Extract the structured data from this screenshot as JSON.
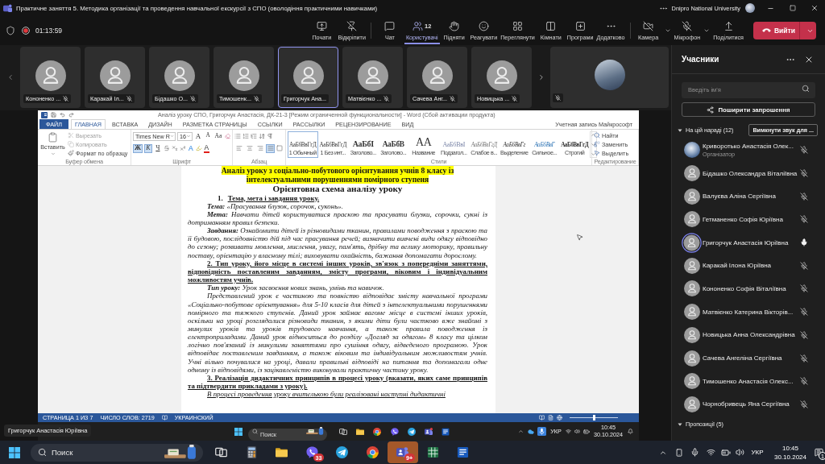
{
  "window": {
    "title": "Практичне заняття 5. Методика організації та проведення навчальної екскурсії з СПО (оволодіння практичними навичками)",
    "organization": "Dnipro National University"
  },
  "meeting_bar": {
    "recording": true,
    "timer": "01:13:59",
    "actions": [
      {
        "kind": "present",
        "label": "Почати",
        "selected": false
      },
      {
        "kind": "unpin",
        "label": "Відкріпити",
        "selected": false
      },
      {
        "kind": "chat",
        "label": "Чат",
        "selected": false
      },
      {
        "kind": "people",
        "label": "Користувачі",
        "count": "12",
        "selected": true
      },
      {
        "kind": "raise",
        "label": "Підняти",
        "selected": false
      },
      {
        "kind": "react",
        "label": "Реагувати",
        "selected": false
      },
      {
        "kind": "view",
        "label": "Переглянути",
        "selected": false
      },
      {
        "kind": "rooms",
        "label": "Кімнати",
        "selected": false
      },
      {
        "kind": "apps",
        "label": "Програми",
        "selected": false
      },
      {
        "kind": "more",
        "label": "Додатково",
        "selected": false
      }
    ],
    "devices": [
      {
        "kind": "camera",
        "label": "Камера",
        "on": false
      },
      {
        "kind": "mic",
        "label": "Мікрофон",
        "on": false
      },
      {
        "kind": "share",
        "label": "Поділитися"
      }
    ],
    "leave": "Вийти"
  },
  "gallery": {
    "tiles": [
      {
        "name": "Кононенко ...",
        "muted": true,
        "speaking": false
      },
      {
        "name": "Каракай Іл...",
        "muted": true,
        "speaking": false
      },
      {
        "name": "Бідашко О...",
        "muted": true,
        "speaking": false
      },
      {
        "name": "Тимошенк...",
        "muted": true,
        "speaking": false
      },
      {
        "name": "Григорчук Ана...",
        "muted": false,
        "speaking": true
      },
      {
        "name": "Матвієнко ...",
        "muted": true,
        "speaking": false
      },
      {
        "name": "Сачева Анг...",
        "muted": true,
        "speaking": false
      },
      {
        "name": "Новицька ...",
        "muted": true,
        "speaking": false
      }
    ],
    "self": {
      "muted": true
    }
  },
  "shared_screen": {
    "presenter": "Григорчук Анастасія Юріївна",
    "word": {
      "title": "Аналіз уроку СПО, Григорчук Анастасія, ДК-21-3 [Режим ограниченной функциональности] - Word (Сбой активации продукта)",
      "tabs": [
        {
          "kind": "file",
          "label": "ФАЙЛ",
          "selected": false
        },
        {
          "kind": "tab",
          "label": "ГЛАВНАЯ",
          "selected": true
        },
        {
          "kind": "tab",
          "label": "ВСТАВКА",
          "selected": false
        },
        {
          "kind": "tab",
          "label": "ДИЗАЙН",
          "selected": false
        },
        {
          "kind": "tab",
          "label": "РАЗМЕТКА СТРАНИЦЫ",
          "selected": false
        },
        {
          "kind": "tab",
          "label": "ССЫЛКИ",
          "selected": false
        },
        {
          "kind": "tab",
          "label": "РАССЫЛКИ",
          "selected": false
        },
        {
          "kind": "tab",
          "label": "РЕЦЕНЗИРОВАНИЕ",
          "selected": false
        },
        {
          "kind": "tab",
          "label": "ВИД",
          "selected": false
        }
      ],
      "account": "Учетная запись Майкрософт",
      "clipboard": {
        "paste": "Вставить",
        "items": [
          {
            "kind": "cut",
            "label": "Вырезать",
            "disabled": true
          },
          {
            "kind": "copy",
            "label": "Копировать",
            "disabled": true
          },
          {
            "kind": "format",
            "label": "Формат по образцу",
            "disabled": false
          }
        ],
        "group": "Буфер обмена"
      },
      "font": {
        "name": "Times New R",
        "size": "16",
        "size_buttons": [
          {
            "kind": "grow",
            "label": "A"
          },
          {
            "kind": "shrink",
            "label": "A"
          },
          {
            "kind": "case",
            "label": "Аа"
          }
        ],
        "toggles": [
          {
            "kind": "bold",
            "label": "Ж",
            "selected": true
          },
          {
            "kind": "italic",
            "label": "К",
            "selected": true
          },
          {
            "kind": "underline",
            "label": "Ч",
            "selected": false
          }
        ],
        "effects": [
          {
            "kind": "effects",
            "label": "A"
          },
          {
            "kind": "font-color",
            "label": "A"
          }
        ],
        "group": "Шрифт"
      },
      "paragraph": {
        "group": "Абзац",
        "alignments": [
          {
            "kind": "left",
            "selected": false
          },
          {
            "kind": "center",
            "selected": false
          },
          {
            "kind": "right",
            "selected": false
          },
          {
            "kind": "justify",
            "selected": true
          }
        ]
      },
      "styles": {
        "group": "Стили",
        "items": [
          {
            "kind": "normal",
            "preview": "АаБбВвГгД",
            "name": "1 Обычный",
            "selected": true
          },
          {
            "kind": "normal",
            "preview": "АаБбВвГгД",
            "name": "1 Без инт...",
            "selected": false
          },
          {
            "kind": "heading1",
            "preview": "АаБбІ",
            "name": "Заголово...",
            "selected": false
          },
          {
            "kind": "heading2",
            "preview": "АаБбВ",
            "name": "Заголово...",
            "selected": false
          },
          {
            "kind": "title",
            "preview": "АА",
            "name": "Название",
            "selected": false
          },
          {
            "kind": "subtitle",
            "preview": "АаБбВвІ",
            "name": "Подзагол...",
            "selected": false
          },
          {
            "kind": "subtle",
            "preview": "АаБбВвГгД",
            "name": "Слабое в...",
            "selected": false
          },
          {
            "kind": "emphasis",
            "preview": "АаБбВвГг",
            "name": "Выделение",
            "selected": false
          },
          {
            "kind": "intense",
            "preview": "АаБбВвГ",
            "name": "Сильное...",
            "selected": false
          },
          {
            "kind": "strong",
            "preview": "АаБбВвГгД",
            "name": "Строгий",
            "selected": false
          }
        ]
      },
      "editing": {
        "group": "Редактирование",
        "items": [
          {
            "kind": "find",
            "label": "Найти"
          },
          {
            "kind": "replace",
            "label": "Заменить"
          },
          {
            "kind": "select",
            "label": "Выделить"
          }
        ]
      },
      "document": [
        {
          "kind": "title",
          "lines": [
            "Аналіз уроку з соціально-побутового орієнтування учнів 8 класу із",
            "інтелектуальними порушеннями помірного ступеня"
          ]
        },
        {
          "kind": "subtitle",
          "text": "Орієнтовна схема аналізу уроку"
        },
        {
          "kind": "numbered",
          "number": "1.",
          "text": "Тема, мета і завдання уроку."
        },
        {
          "kind": "body",
          "text": "**Тема:** «Прасування блузок, сорочок, суконь»."
        },
        {
          "kind": "body",
          "text": "**Мета:** Навчати дітей користуватися праскою та прасувати блузки, сорочки, сукні із дотриманням правил безпеки."
        },
        {
          "kind": "body",
          "text": "**Завдання:** Ознайомити дітей із різновидами тканин, правилами поводження з праскою та її будовою, послідовністю дій під час прасування речей; визначити вивчені види одягу відповідно до сезону; розвивати мовлення, мислення, увагу, пам'ять, дрібну та велику моторику, правильну поставу, орієнтацію у власному тілі; виховувати охайність, бажання допомагати дорослому."
        },
        {
          "kind": "heading",
          "text": "2. Тип уроку, його місце в системі інших уроків, зв'язок з попередніми заняттями, відповідність поставленим завданням, змісту програми, віковим і індивідуальним можливостям учнів."
        },
        {
          "kind": "body",
          "text": "**Тип уроку:** Урок засвоєння нових знань, умінь та навичок."
        },
        {
          "kind": "body",
          "text": "Представлений урок є частиною та повністю відповідає змісту навчальної програми «Соціально-побутове орієнтування» для 5-10 класів для дітей з інтелектуальними порушеннями помірного та тяжкого ступенів. Даний урок займає вагоме місце в системі інших уроків, оскільки на уроці розглядалися різновиди тканин, з якими діти були частково вже знайомі з минулих уроків та уроків трудового навчання, а також правила поводження із електроприладами. Даний урок відноситься до розділу «Догляд за одягом» 8 класу та цілком логічно пов'язаний із минулими заняттями про сушіння одягу, відведеного програмою. Урок відповідає поставленим завданням, а також віковим та індивідуальним можливостям учнів. Учні вільно почувалися на уроці, давали правильні відповіді на питання та допомагали одне одному із відповідями, із зацікавленістю виконували практичну частину уроку."
        },
        {
          "kind": "heading",
          "text": "3. Реалізація дидактичних принципів в процесі уроку (вказати, яких саме принципів та підтвердити прикладами з уроку)."
        },
        {
          "kind": "body",
          "underlined": true,
          "text": "В процесі проведення уроку вчителькою були реалізовані наступні дидактичні"
        }
      ],
      "status": {
        "items": [
          "СТРАНИЦА 1 ИЗ 7",
          "ЧИСЛО СЛОВ: 2719",
          "УКРАИНСКИЙ"
        ],
        "zoom": {
          "level": 0.5
        }
      }
    },
    "taskbar": {
      "search": {
        "placeholder": "Поиск"
      },
      "apps": [
        {
          "kind": "taskview",
          "alert": false
        },
        {
          "kind": "folder",
          "alert": false
        },
        {
          "kind": "browser",
          "alert": false
        },
        {
          "kind": "call",
          "alert": false
        },
        {
          "kind": "send",
          "alert": false
        },
        {
          "kind": "team",
          "alert": true
        },
        {
          "kind": "document",
          "alert": false
        }
      ],
      "language": "УКР",
      "time": "10:45",
      "date": "30.10.2024"
    }
  },
  "participants_panel": {
    "title": "Учасники",
    "search": {
      "placeholder": "Введіть ім'я"
    },
    "invite": "Поширити запрошення",
    "in_meeting": {
      "label": "На цій нараді (12)",
      "expanded": true,
      "mute_all": "Вимкнути звук для ...",
      "people": [
        {
          "name": "Криворотько Анастасія Олек...",
          "role": "Організатор",
          "kind": "photo",
          "muted": true,
          "speaking": false
        },
        {
          "name": "Бідашко Олександра Віталіївна",
          "kind": "default",
          "muted": true,
          "speaking": false
        },
        {
          "name": "Валуєва Аліна Сергіївна",
          "kind": "default",
          "muted": true,
          "speaking": false
        },
        {
          "name": "Гетманенко Софія Юріївна",
          "kind": "default",
          "muted": true,
          "speaking": false
        },
        {
          "name": "Григорчук Анастасія Юріївна",
          "kind": "default",
          "muted": false,
          "speaking": true
        },
        {
          "name": "Каракай Ілона Юріївна",
          "kind": "default",
          "muted": true,
          "speaking": false
        },
        {
          "name": "Кононенко Софія Віталіївна",
          "kind": "default",
          "muted": true,
          "speaking": false
        },
        {
          "name": "Матвієнко Катерина Вікторів...",
          "kind": "default",
          "muted": true,
          "speaking": false
        },
        {
          "name": "Новицька Анна Олександрівна",
          "kind": "default",
          "muted": true,
          "speaking": false
        },
        {
          "name": "Сачева Ангеліна Сергіївна",
          "kind": "default",
          "muted": true,
          "speaking": false
        },
        {
          "name": "Тимошенко Анастасія Олекс...",
          "kind": "default",
          "muted": true,
          "speaking": false
        },
        {
          "name": "Чорнобривець Яна Сергіївна",
          "kind": "default",
          "muted": true,
          "speaking": false
        }
      ]
    },
    "suggestions": {
      "label": "Пропозиції (5)",
      "expanded": true
    }
  },
  "taskbar": {
    "search": {
      "placeholder": "Поиск"
    },
    "apps": [
      {
        "kind": "taskview",
        "flashing": false
      },
      {
        "kind": "calculator",
        "flashing": false
      },
      {
        "kind": "folder",
        "flashing": false
      },
      {
        "kind": "call",
        "badge": "33",
        "flashing": false
      },
      {
        "kind": "send",
        "flashing": false
      },
      {
        "kind": "browser",
        "flashing": false
      },
      {
        "kind": "team",
        "badge": "9+",
        "flashing": true
      },
      {
        "kind": "spreadsheet",
        "flashing": false
      },
      {
        "kind": "document",
        "flashing": false
      }
    ],
    "language": "УКР",
    "time": "10:45",
    "date": "30.10.2024",
    "notifications": "1"
  }
}
